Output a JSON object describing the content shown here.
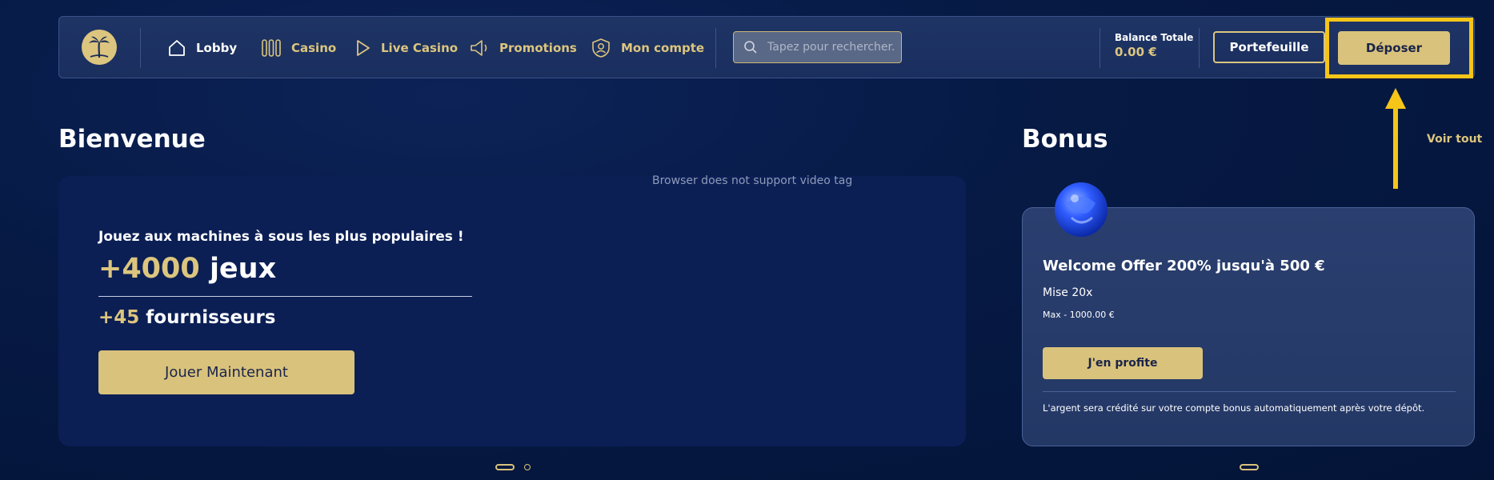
{
  "nav": {
    "items": [
      {
        "label": "Lobby",
        "icon": "home-icon",
        "active": true
      },
      {
        "label": "Casino",
        "icon": "slots-icon"
      },
      {
        "label": "Live Casino",
        "icon": "play-icon"
      },
      {
        "label": "Promotions",
        "icon": "megaphone-icon"
      },
      {
        "label": "Mon compte",
        "icon": "user-shield-icon"
      }
    ],
    "search_placeholder": "Tapez pour rechercher...",
    "balance_label": "Balance Totale",
    "balance_value": "0.00 €",
    "wallet_label": "Portefeuille",
    "deposit_label": "Déposer"
  },
  "welcome": {
    "title": "Bienvenue",
    "video_note": "Browser does not support video tag",
    "tagline": "Jouez aux machines à sous les plus populaires !",
    "games_num": "+4000",
    "games_word": "jeux",
    "providers_num": "+45",
    "providers_word": "fournisseurs",
    "cta": "Jouer Maintenant"
  },
  "bonus": {
    "title": "Bonus",
    "see_all": "Voir tout",
    "offer_title": "Welcome Offer 200% jusqu'à 500 €",
    "wager": "Mise 20x",
    "max": "Max - 1000.00 €",
    "cta": "J'en profite",
    "note": "L'argent sera crédité sur votre compte bonus automatiquement après votre dépôt."
  },
  "colors": {
    "accent_gold": "#d9c27c",
    "background": "#061a45",
    "highlight": "#f5c518"
  }
}
